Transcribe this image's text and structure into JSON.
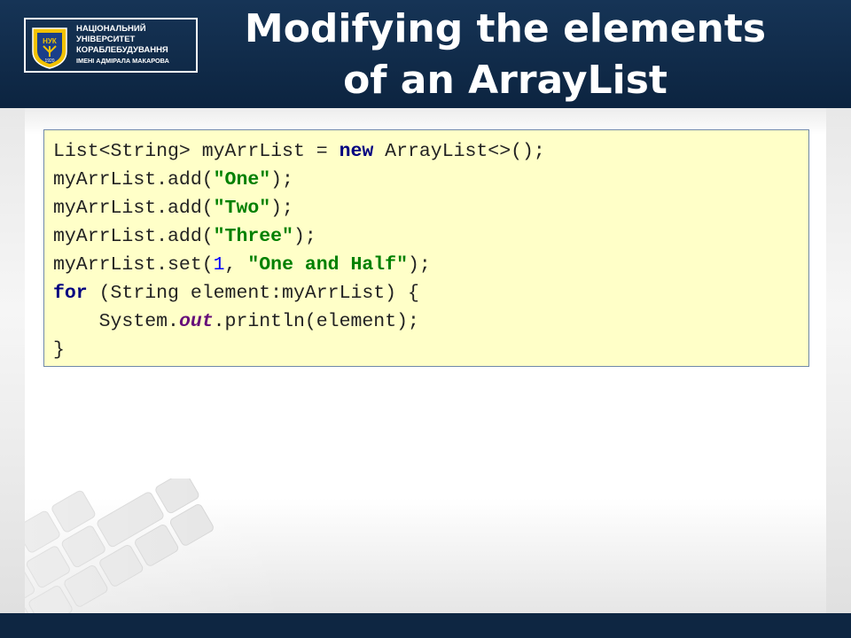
{
  "university": {
    "line1": "НАЦІОНАЛЬНИЙ",
    "line2": "УНІВЕРСИТЕТ",
    "line3": "КОРАБЛЕБУДУВАННЯ",
    "line4": "ІМЕНІ АДМІРАЛА МАКАРОВА",
    "crest_abbr": "НУК",
    "crest_year": "1920"
  },
  "slide": {
    "title_line1": "Modifying the elements",
    "title_line2": "of an ArrayList"
  },
  "code": {
    "line1": {
      "a": "List<String> myArrList = ",
      "kw": "new",
      "b": " ArrayList<>();"
    },
    "line2": {
      "a": "myArrList.add(",
      "str": "\"One\"",
      "b": ");"
    },
    "line3": {
      "a": "myArrList.add(",
      "str": "\"Two\"",
      "b": ");"
    },
    "line4": {
      "a": "myArrList.add(",
      "str": "\"Three\"",
      "b": ");"
    },
    "line5": {
      "a": "myArrList.set(",
      "num": "1",
      "b": ", ",
      "str": "\"One and Half\"",
      "c": ");"
    },
    "line6": {
      "kw": "for",
      "a": " (String element:myArrList) {"
    },
    "line7": {
      "a": "    System.",
      "fld": "out",
      "b": ".println(element);"
    },
    "line8": {
      "a": "}"
    }
  },
  "colors": {
    "header_bg": "#163456",
    "code_bg": "#ffffc8",
    "keyword": "#000080",
    "string": "#008000",
    "number": "#0000ff",
    "field": "#660e7a"
  }
}
